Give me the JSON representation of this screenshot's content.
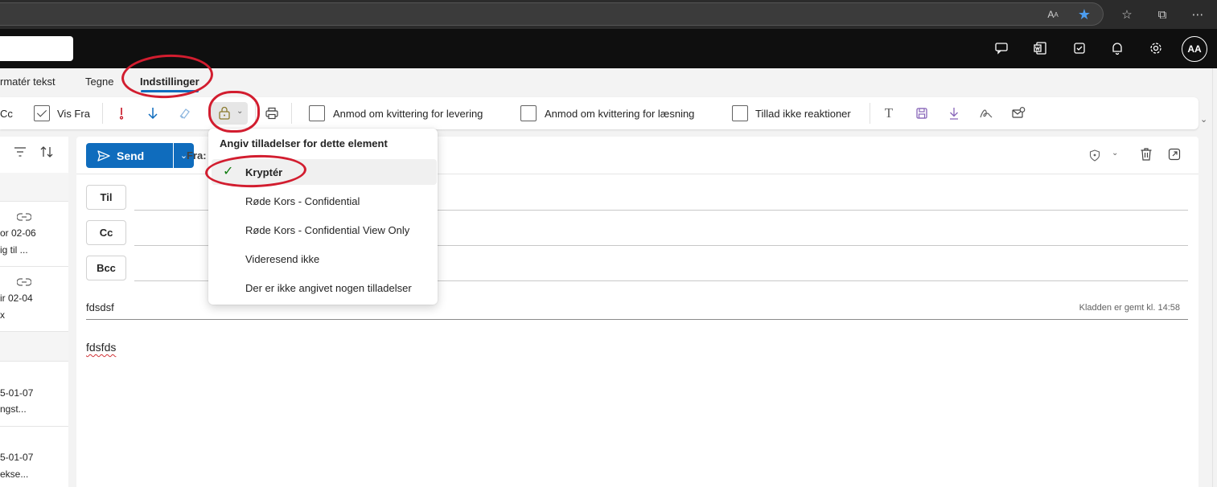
{
  "browser": {
    "icons": [
      "read-aloud-icon",
      "favorite-star-icon",
      "favorites-icon",
      "collections-icon",
      "more-icon"
    ]
  },
  "header": {
    "avatar_initials": "AA",
    "icons": [
      "teams-chat-icon",
      "word-icon",
      "todo-icon",
      "bell-icon",
      "gear-icon"
    ]
  },
  "tabs": [
    {
      "label": "rmatér tekst"
    },
    {
      "label": "Tegne"
    },
    {
      "label": "Indstillinger",
      "active": true
    }
  ],
  "ribbon": {
    "cc_label": "Cc",
    "vis_fra_label": "Vis Fra",
    "vis_fra_checked": true,
    "delivery_receipt_label": "Anmod om kvittering for levering",
    "read_receipt_label": "Anmod om kvittering for læsning",
    "no_reactions_label": "Tillad ikke reaktioner"
  },
  "mail_list": {
    "items": [
      {
        "date": "or 02-06",
        "preview": "ig til ..."
      },
      {
        "date": "ir 02-04",
        "preview": "x"
      },
      {
        "date": "5-01-07",
        "preview": "ngst..."
      },
      {
        "date": "5-01-07",
        "preview": "ekse..."
      }
    ]
  },
  "compose": {
    "send_label": "Send",
    "from_label": "Fra:",
    "to_label": "Til",
    "cc_label": "Cc",
    "bcc_label": "Bcc",
    "subject": "fdsdsf",
    "draft_status": "Kladden er gemt kl. 14:58",
    "body": "fdsfds"
  },
  "permissions_menu": {
    "title": "Angiv tilladelser for dette element",
    "items": [
      {
        "label": "Kryptér",
        "selected": true
      },
      {
        "label": "Røde Kors - Confidential",
        "selected": false
      },
      {
        "label": "Røde Kors - Confidential View Only",
        "selected": false
      },
      {
        "label": "Videresend ikke",
        "selected": false
      },
      {
        "label": "Der er ikke angivet nogen tilladelser",
        "selected": false
      }
    ]
  },
  "colors": {
    "accent": "#0f6cbd",
    "annotation": "#d21d2f",
    "check": "#107c10"
  }
}
